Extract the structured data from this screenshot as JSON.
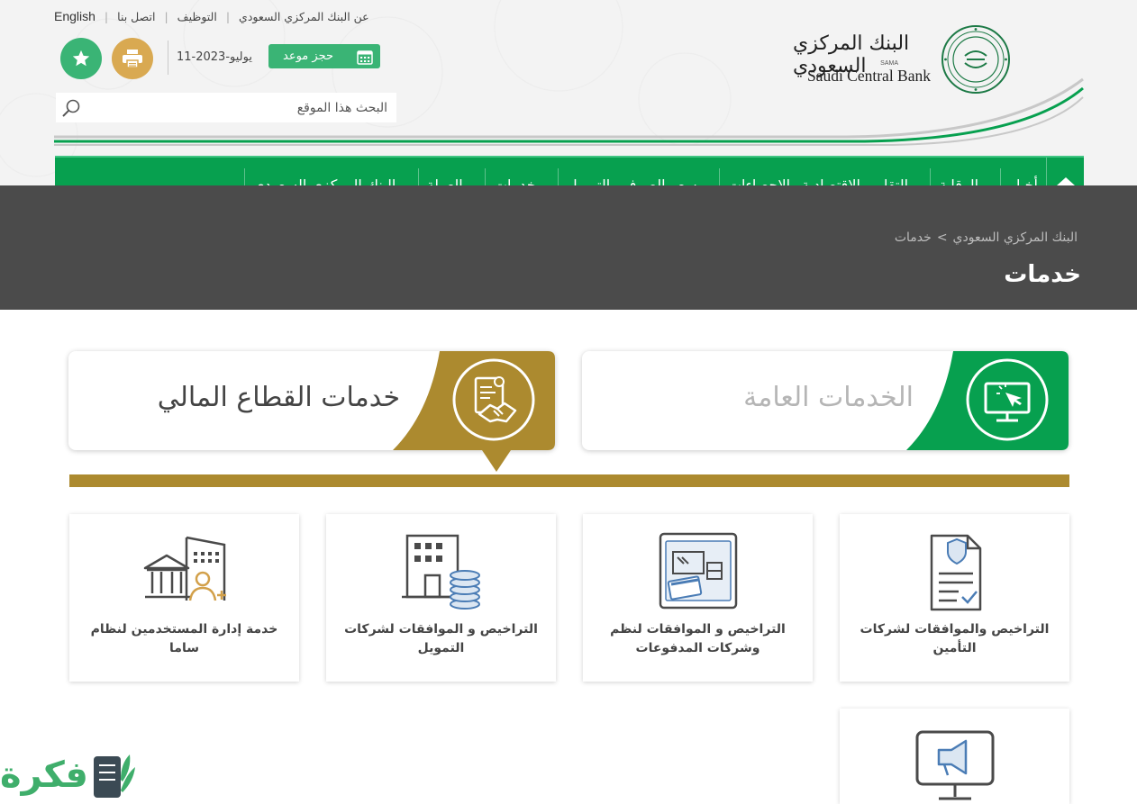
{
  "top_links": {
    "about": "عن البنك المركزي السعودي",
    "careers": "التوظيف",
    "contact": "اتصل بنا",
    "language": "English"
  },
  "header": {
    "date": "11-يوليو-2023",
    "appointment_label": "حجز موعد",
    "search_placeholder": "البحث هذا الموقع"
  },
  "logo": {
    "arabic_name": "البنك المركزي السعودي",
    "sama": "SAMA",
    "english_name": "Saudi Central Bank"
  },
  "nav": {
    "items": [
      {
        "label": "أخبار",
        "has_menu": false
      },
      {
        "label": "الرقابة",
        "has_menu": true
      },
      {
        "label": "التقارير الاقتصادية والإحصاءات",
        "has_menu": true
      },
      {
        "label": "سعر الصرف والتمويل",
        "has_menu": true
      },
      {
        "label": "خدمات",
        "has_menu": true
      },
      {
        "label": "العملة",
        "has_menu": true
      },
      {
        "label": "البنك المركزي السعودي",
        "has_menu": true
      }
    ]
  },
  "breadcrumb": {
    "root": "البنك المركزي السعودي",
    "separator": ">",
    "current": "خدمات"
  },
  "page_title": "خدمات",
  "categories": {
    "general": "الخدمات العامة",
    "financial": "خدمات القطاع المالي"
  },
  "services": [
    {
      "label": "التراخيص والموافقات لشركات التأمين",
      "icon": "insurance-document-icon"
    },
    {
      "label": "التراخيص و الموافقات لنظم وشركات المدفوعات",
      "icon": "payment-terminal-icon"
    },
    {
      "label": "التراخيص و الموافقات لشركات التمويل",
      "icon": "finance-building-coins-icon"
    },
    {
      "label": "خدمة إدارة المستخدمين لنظام ساما",
      "icon": "bank-user-management-icon"
    },
    {
      "label": "",
      "icon": "announcement-monitor-icon"
    }
  ],
  "colors": {
    "green": "#07a04f",
    "gold": "#ac8a2f",
    "banner_gray": "#4b4b4b"
  },
  "watermark": "فكرة"
}
